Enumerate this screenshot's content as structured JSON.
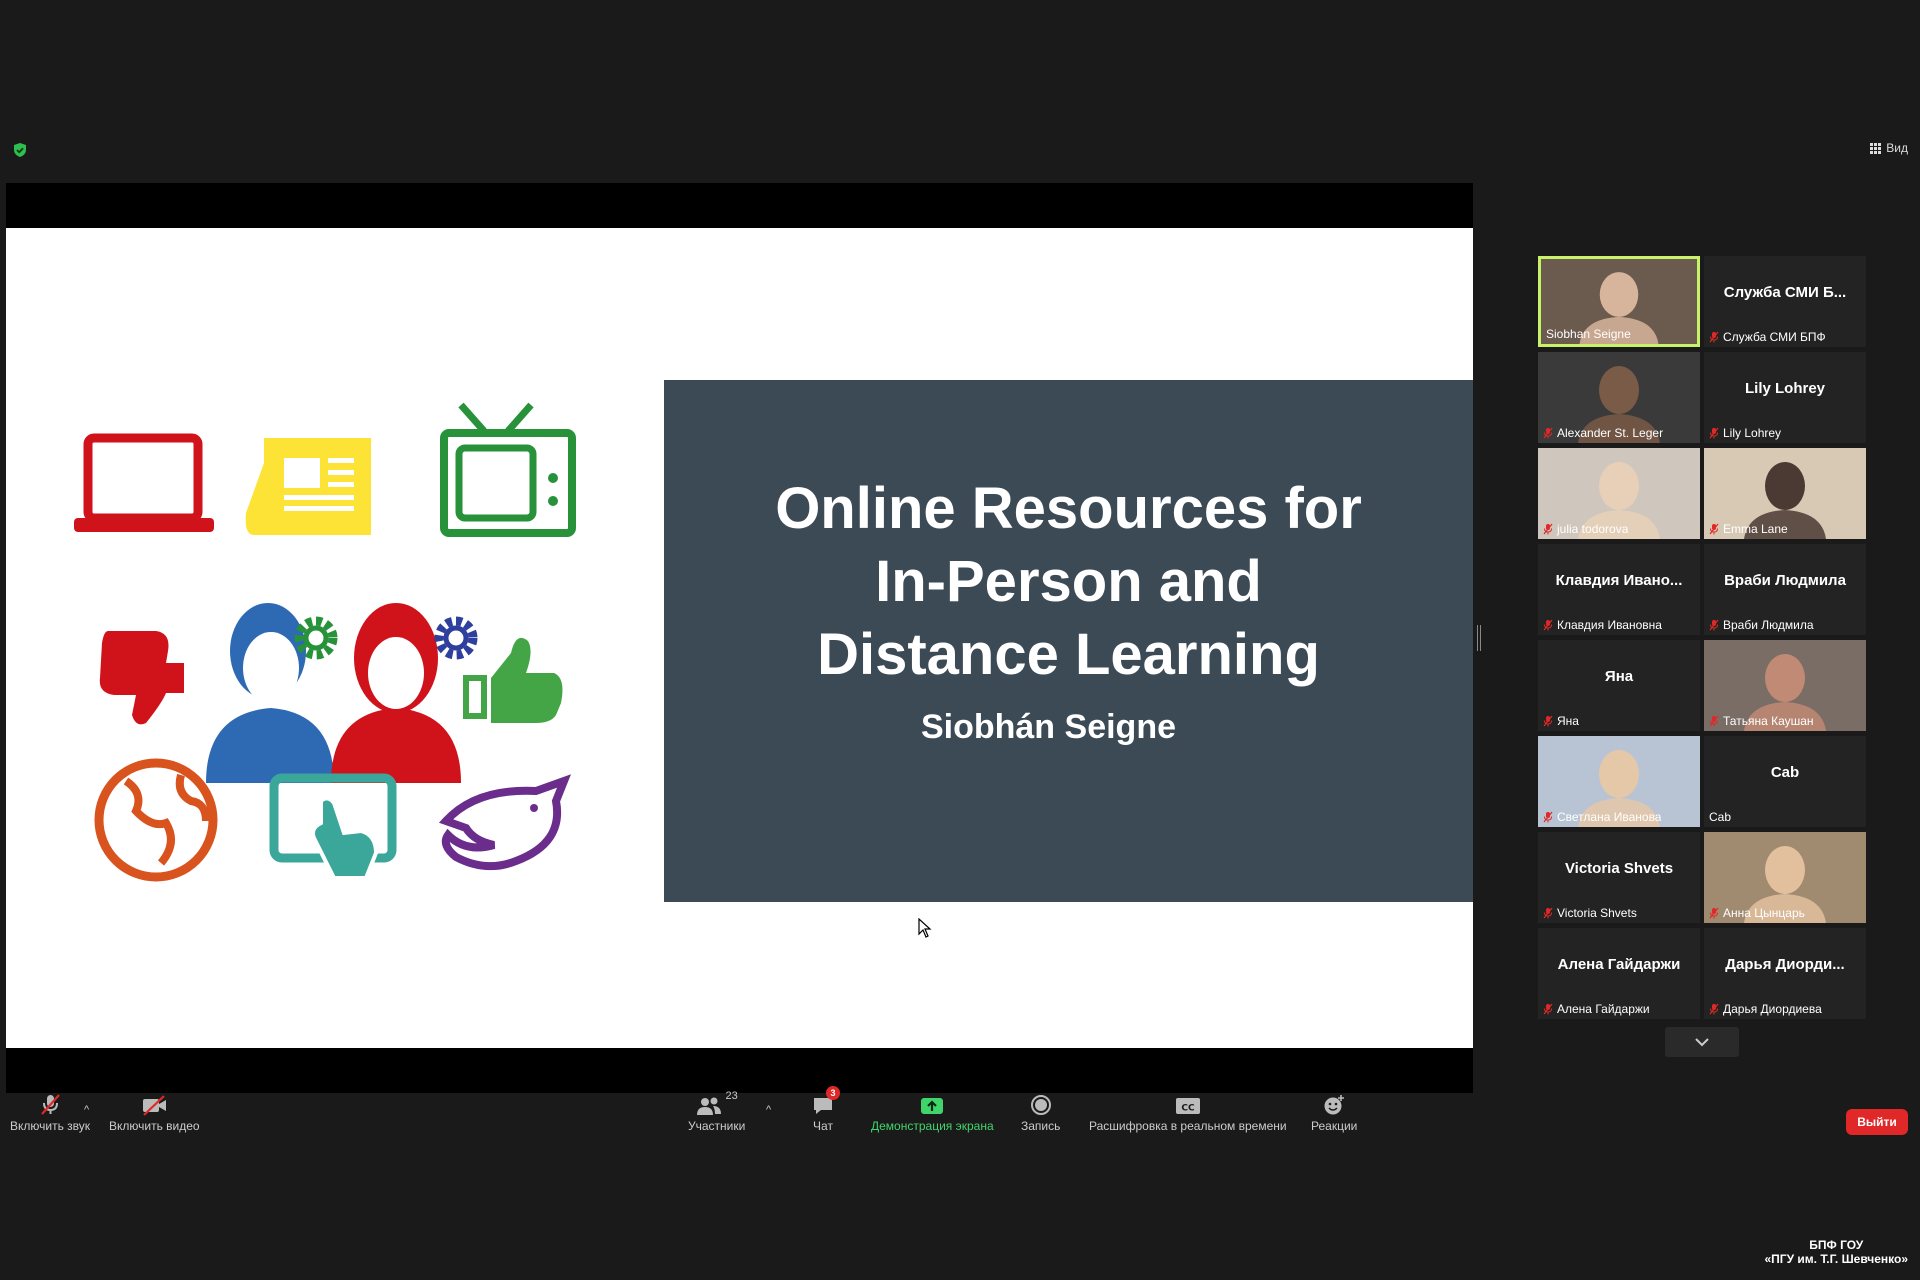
{
  "top": {
    "view_label": "Вид"
  },
  "slide": {
    "title_lines": [
      "Online Resources for",
      "In-Person and",
      "Distance Learning"
    ],
    "author": "Siobhán Seigne"
  },
  "gallery": {
    "tiles": [
      {
        "label": "Siobhan Seigne",
        "center": "",
        "video": true,
        "active": true,
        "muted": false
      },
      {
        "label": "Служба СМИ БПФ",
        "center": "Служба СМИ Б...",
        "video": false,
        "active": false,
        "muted": true
      },
      {
        "label": "Alexander St. Leger",
        "center": "",
        "video": true,
        "active": false,
        "muted": true
      },
      {
        "label": "Lily Lohrey",
        "center": "Lily Lohrey",
        "video": false,
        "active": false,
        "muted": true
      },
      {
        "label": "julia todorova",
        "center": "",
        "video": true,
        "active": false,
        "muted": true
      },
      {
        "label": "Emma Lane",
        "center": "",
        "video": true,
        "active": false,
        "muted": true
      },
      {
        "label": "Клавдия Ивановна",
        "center": "Клавдия Ивано...",
        "video": false,
        "active": false,
        "muted": true
      },
      {
        "label": "Враби Людмила",
        "center": "Враби Людмила",
        "video": false,
        "active": false,
        "muted": true
      },
      {
        "label": "Яна",
        "center": "Яна",
        "video": false,
        "active": false,
        "muted": true
      },
      {
        "label": "Татьяна Каушан",
        "center": "",
        "video": true,
        "active": false,
        "muted": true
      },
      {
        "label": "Светлана Иванова",
        "center": "",
        "video": true,
        "active": false,
        "muted": true
      },
      {
        "label": "Cab",
        "center": "Cab",
        "video": false,
        "active": false,
        "muted": false
      },
      {
        "label": "Victoria Shvets",
        "center": "Victoria Shvets",
        "video": false,
        "active": false,
        "muted": true
      },
      {
        "label": "Анна Цынцарь",
        "center": "",
        "video": true,
        "active": false,
        "muted": true
      },
      {
        "label": "Алена Гайдаржи",
        "center": "Алена Гайдаржи",
        "video": false,
        "active": false,
        "muted": true
      },
      {
        "label": "Дарья Диордиева",
        "center": "Дарья Диорди...",
        "video": false,
        "active": false,
        "muted": true
      }
    ]
  },
  "toolbar": {
    "audio": "Включить звук",
    "video": "Включить видео",
    "participants": "Участники",
    "participants_count": "23",
    "chat": "Чат",
    "chat_badge": "3",
    "share": "Демонстрация экрана",
    "record": "Запись",
    "captions": "Расшифровка в реальном времени",
    "reactions": "Реакции",
    "leave": "Выйти"
  },
  "watermark": {
    "line1": "БПФ ГОУ",
    "line2": "«ПГУ им. Т.Г. Шевченко»"
  },
  "colors": {
    "accent_green": "#3fd56b",
    "leave_red": "#e02828",
    "active_border": "#c9f26b",
    "slide_panel": "#3b4a55"
  }
}
